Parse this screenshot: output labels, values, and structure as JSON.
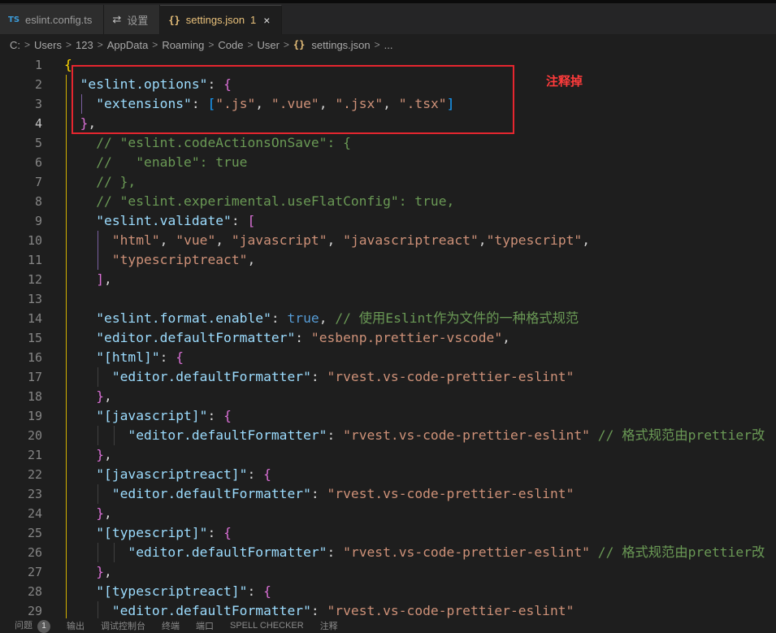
{
  "tabs": [
    {
      "icon": "TS",
      "label": "eslint.config.ts"
    },
    {
      "icon": "⇄",
      "label": "设置"
    },
    {
      "icon": "{}",
      "label": "settings.json",
      "dirty": "1",
      "close": "×"
    }
  ],
  "breadcrumb": {
    "items": [
      "C:",
      "Users",
      "123",
      "AppData",
      "Roaming",
      "Code",
      "User",
      "settings.json",
      "..."
    ],
    "json_icon": "{}",
    "separator": ">"
  },
  "annotation": {
    "label": "注释掉",
    "color": "#e5262f"
  },
  "editor": {
    "current_line": 4,
    "lines": [
      {
        "n": 1,
        "tokens": [
          [
            "b1",
            "{"
          ]
        ]
      },
      {
        "n": 2,
        "tokens": [
          [
            "pun",
            "  "
          ],
          [
            "key",
            "\"eslint.options\""
          ],
          [
            "pun",
            ": "
          ],
          [
            "b2",
            "{"
          ]
        ]
      },
      {
        "n": 3,
        "tokens": [
          [
            "pun",
            "    "
          ],
          [
            "key",
            "\"extensions\""
          ],
          [
            "pun",
            ": "
          ],
          [
            "b3",
            "["
          ],
          [
            "str",
            "\".js\""
          ],
          [
            "pun",
            ", "
          ],
          [
            "str",
            "\".vue\""
          ],
          [
            "pun",
            ", "
          ],
          [
            "str",
            "\".jsx\""
          ],
          [
            "pun",
            ", "
          ],
          [
            "str",
            "\".tsx\""
          ],
          [
            "b3",
            "]"
          ]
        ]
      },
      {
        "n": 4,
        "tokens": [
          [
            "pun",
            "  "
          ],
          [
            "b2",
            "}"
          ],
          [
            "pun",
            ","
          ]
        ]
      },
      {
        "n": 5,
        "tokens": [
          [
            "cm",
            "    // \"eslint.codeActionsOnSave\": {"
          ]
        ]
      },
      {
        "n": 6,
        "tokens": [
          [
            "cm",
            "    //   \"enable\": true"
          ]
        ]
      },
      {
        "n": 7,
        "tokens": [
          [
            "cm",
            "    // },"
          ]
        ]
      },
      {
        "n": 8,
        "tokens": [
          [
            "cm",
            "    // \"eslint.experimental.useFlatConfig\": true,"
          ]
        ]
      },
      {
        "n": 9,
        "tokens": [
          [
            "pun",
            "    "
          ],
          [
            "key",
            "\"eslint.validate\""
          ],
          [
            "pun",
            ": "
          ],
          [
            "b2",
            "["
          ]
        ]
      },
      {
        "n": 10,
        "tokens": [
          [
            "pun",
            "      "
          ],
          [
            "str",
            "\"html\""
          ],
          [
            "pun",
            ", "
          ],
          [
            "str",
            "\"vue\""
          ],
          [
            "pun",
            ", "
          ],
          [
            "str",
            "\"javascript\""
          ],
          [
            "pun",
            ", "
          ],
          [
            "str",
            "\"javascriptreact\""
          ],
          [
            "pun",
            ","
          ],
          [
            "str",
            "\"typescript\""
          ],
          [
            "pun",
            ","
          ]
        ]
      },
      {
        "n": 11,
        "tokens": [
          [
            "pun",
            "      "
          ],
          [
            "str",
            "\"typescriptreact\""
          ],
          [
            "pun",
            ","
          ]
        ]
      },
      {
        "n": 12,
        "tokens": [
          [
            "pun",
            "    "
          ],
          [
            "b2",
            "]"
          ],
          [
            "pun",
            ","
          ]
        ]
      },
      {
        "n": 13,
        "tokens": []
      },
      {
        "n": 14,
        "tokens": [
          [
            "pun",
            "    "
          ],
          [
            "key",
            "\"eslint.format.enable\""
          ],
          [
            "pun",
            ": "
          ],
          [
            "kw",
            "true"
          ],
          [
            "pun",
            ", "
          ],
          [
            "cm",
            "// 使用Eslint作为文件的一种格式规范"
          ]
        ]
      },
      {
        "n": 15,
        "tokens": [
          [
            "pun",
            "    "
          ],
          [
            "key",
            "\"editor.defaultFormatter\""
          ],
          [
            "pun",
            ": "
          ],
          [
            "str",
            "\"esbenp.prettier-vscode\""
          ],
          [
            "pun",
            ","
          ]
        ]
      },
      {
        "n": 16,
        "tokens": [
          [
            "pun",
            "    "
          ],
          [
            "key",
            "\"[html]\""
          ],
          [
            "pun",
            ": "
          ],
          [
            "b2",
            "{"
          ]
        ]
      },
      {
        "n": 17,
        "tokens": [
          [
            "pun",
            "      "
          ],
          [
            "key",
            "\"editor.defaultFormatter\""
          ],
          [
            "pun",
            ": "
          ],
          [
            "str",
            "\"rvest.vs-code-prettier-eslint\""
          ]
        ]
      },
      {
        "n": 18,
        "tokens": [
          [
            "pun",
            "    "
          ],
          [
            "b2",
            "}"
          ],
          [
            "pun",
            ","
          ]
        ]
      },
      {
        "n": 19,
        "tokens": [
          [
            "pun",
            "    "
          ],
          [
            "key",
            "\"[javascript]\""
          ],
          [
            "pun",
            ": "
          ],
          [
            "b2",
            "{"
          ]
        ]
      },
      {
        "n": 20,
        "tokens": [
          [
            "pun",
            "        "
          ],
          [
            "key",
            "\"editor.defaultFormatter\""
          ],
          [
            "pun",
            ": "
          ],
          [
            "str",
            "\"rvest.vs-code-prettier-eslint\""
          ],
          [
            "pun",
            " "
          ],
          [
            "cm",
            "// 格式规范由prettier改"
          ]
        ]
      },
      {
        "n": 21,
        "tokens": [
          [
            "pun",
            "    "
          ],
          [
            "b2",
            "}"
          ],
          [
            "pun",
            ","
          ]
        ]
      },
      {
        "n": 22,
        "tokens": [
          [
            "pun",
            "    "
          ],
          [
            "key",
            "\"[javascriptreact]\""
          ],
          [
            "pun",
            ": "
          ],
          [
            "b2",
            "{"
          ]
        ]
      },
      {
        "n": 23,
        "tokens": [
          [
            "pun",
            "      "
          ],
          [
            "key",
            "\"editor.defaultFormatter\""
          ],
          [
            "pun",
            ": "
          ],
          [
            "str",
            "\"rvest.vs-code-prettier-eslint\""
          ]
        ]
      },
      {
        "n": 24,
        "tokens": [
          [
            "pun",
            "    "
          ],
          [
            "b2",
            "}"
          ],
          [
            "pun",
            ","
          ]
        ]
      },
      {
        "n": 25,
        "tokens": [
          [
            "pun",
            "    "
          ],
          [
            "key",
            "\"[typescript]\""
          ],
          [
            "pun",
            ": "
          ],
          [
            "b2",
            "{"
          ]
        ]
      },
      {
        "n": 26,
        "tokens": [
          [
            "pun",
            "        "
          ],
          [
            "key",
            "\"editor.defaultFormatter\""
          ],
          [
            "pun",
            ": "
          ],
          [
            "str",
            "\"rvest.vs-code-prettier-eslint\""
          ],
          [
            "pun",
            " "
          ],
          [
            "cm",
            "// 格式规范由prettier改"
          ]
        ]
      },
      {
        "n": 27,
        "tokens": [
          [
            "pun",
            "    "
          ],
          [
            "b2",
            "}"
          ],
          [
            "pun",
            ","
          ]
        ]
      },
      {
        "n": 28,
        "tokens": [
          [
            "pun",
            "    "
          ],
          [
            "key",
            "\"[typescriptreact]\""
          ],
          [
            "pun",
            ": "
          ],
          [
            "b2",
            "{"
          ]
        ]
      },
      {
        "n": 29,
        "tokens": [
          [
            "pun",
            "      "
          ],
          [
            "key",
            "\"editor.defaultFormatter\""
          ],
          [
            "pun",
            ": "
          ],
          [
            "str",
            "\"rvest.vs-code-prettier-eslint\""
          ]
        ]
      }
    ]
  },
  "panel": {
    "tabs": [
      "问题",
      "输出",
      "调试控制台",
      "终端",
      "端口",
      "SPELL CHECKER",
      "注释"
    ],
    "problems_count": "1"
  }
}
